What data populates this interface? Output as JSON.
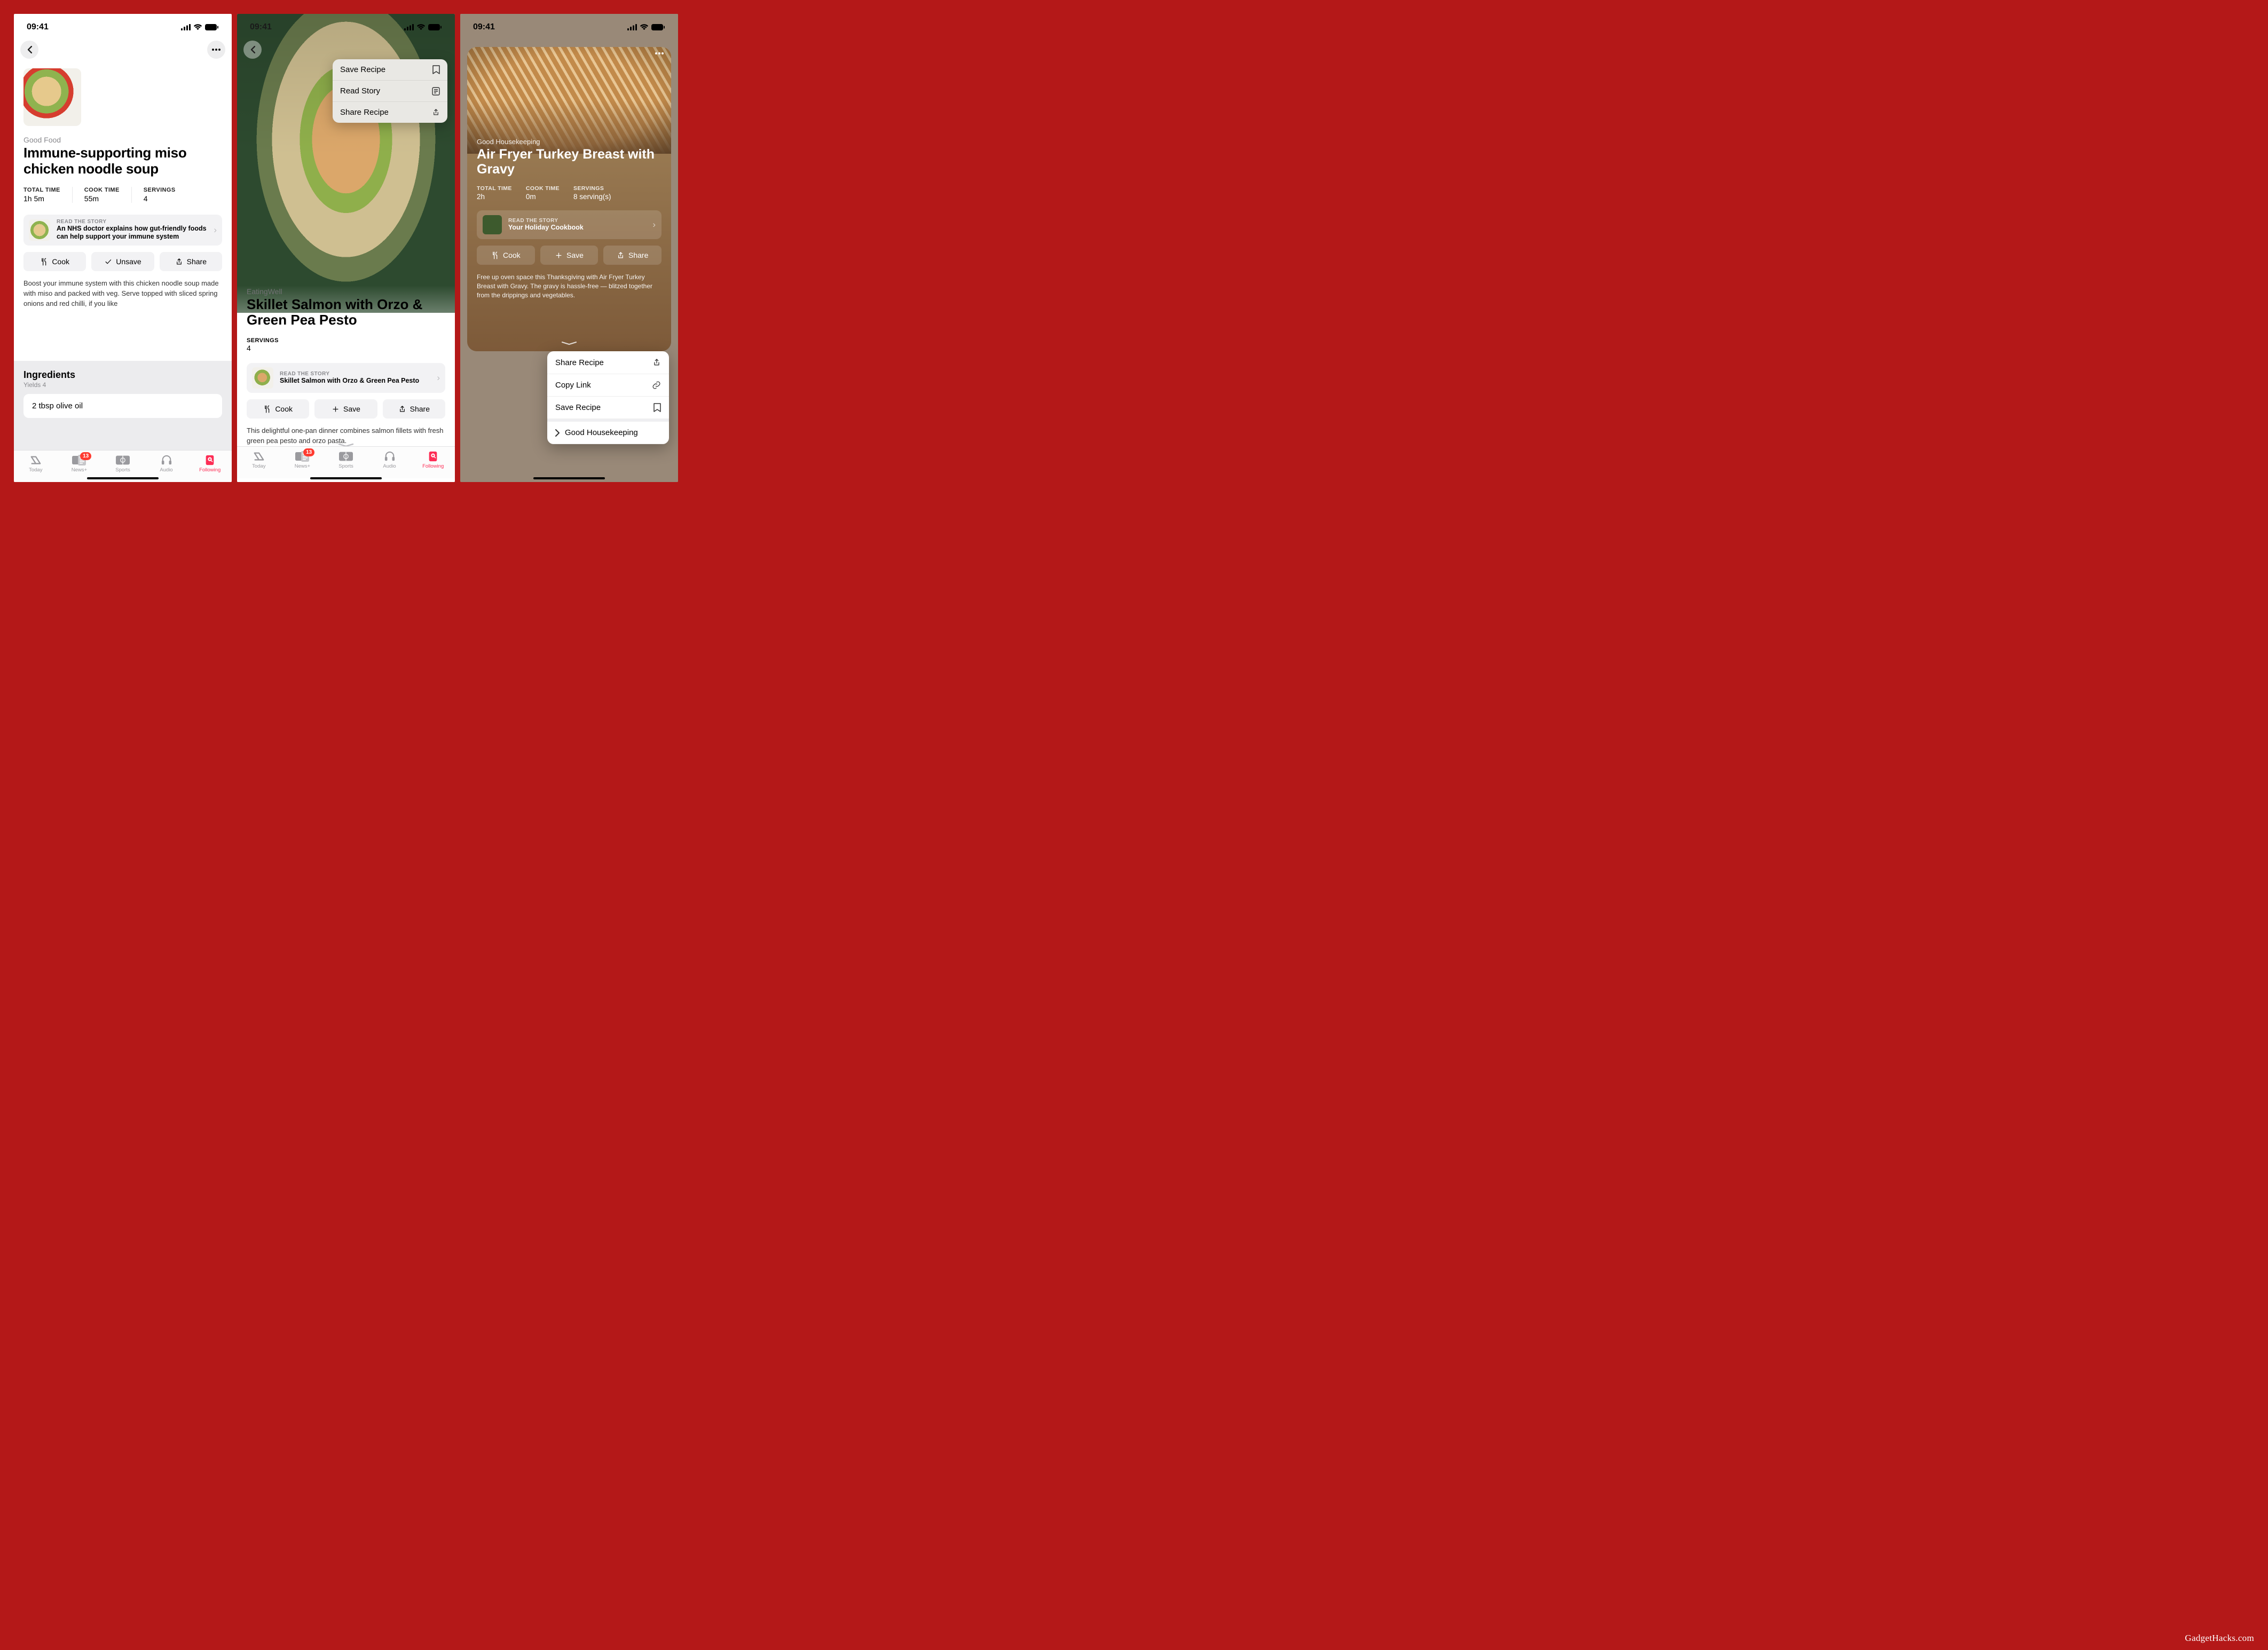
{
  "status_time": "09:41",
  "tabbar": [
    "Today",
    "News+",
    "Sports",
    "Audio",
    "Following"
  ],
  "news_badge": "13",
  "screen1": {
    "source": "Good Food",
    "title": "Immune-supporting miso chicken noodle soup",
    "total_label": "TOTAL TIME",
    "total": "1h 5m",
    "cook_label": "COOK TIME",
    "cook": "55m",
    "serv_label": "SERVINGS",
    "serv": "4",
    "story_label": "READ THE STORY",
    "story_title": "An NHS doctor explains how gut-friendly foods can help support your immune system",
    "btn_cook": "Cook",
    "btn_unsave": "Unsave",
    "btn_share": "Share",
    "desc": "Boost your immune system with this chicken noodle soup made with miso and packed with veg. Serve topped with sliced spring onions and red chilli, if you like",
    "ing_h": "Ingredients",
    "ing_sub": "Yields 4",
    "ing_1": "2 tbsp olive oil"
  },
  "screen2": {
    "source": "EatingWell",
    "title": "Skillet Salmon with Orzo & Green Pea Pesto",
    "serv_label": "SERVINGS",
    "serv": "4",
    "story_label": "READ THE STORY",
    "story_title": "Skillet Salmon with Orzo & Green Pea Pesto",
    "btn_cook": "Cook",
    "btn_save": "Save",
    "btn_share": "Share",
    "desc": "This delightful one-pan dinner combines salmon fillets with fresh green pea pesto and orzo pasta.",
    "popover": {
      "save": "Save Recipe",
      "read": "Read Story",
      "share": "Share Recipe"
    }
  },
  "screen3": {
    "source": "Good Housekeeping",
    "title": "Air Fryer Turkey Breast with Gravy",
    "total_label": "TOTAL TIME",
    "total": "2h",
    "cook_label": "COOK TIME",
    "cook": "0m",
    "serv_label": "SERVINGS",
    "serv": "8 serving(s)",
    "story_label": "READ THE STORY",
    "story_title": "Your Holiday Cookbook",
    "btn_cook": "Cook",
    "btn_save": "Save",
    "btn_share": "Share",
    "desc": "Free up oven space this Thanksgiving with Air Fryer Turkey Breast with Gravy. The gravy is hassle-free — blitzed together from the drippings and vegetables.",
    "sheet": {
      "share": "Share Recipe",
      "copy": "Copy Link",
      "save": "Save Recipe",
      "src": "Good Housekeeping"
    }
  },
  "watermark": "GadgetHacks.com"
}
